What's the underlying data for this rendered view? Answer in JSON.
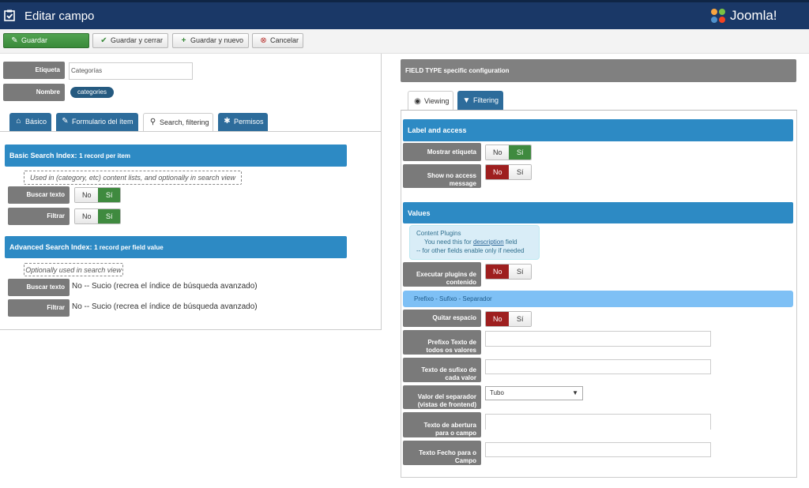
{
  "header": {
    "title": "Editar campo",
    "logo_text": "Joomla!"
  },
  "toolbar": {
    "save": "Guardar",
    "save_close": "Guardar y cerrar",
    "save_new": "Guardar y nuevo",
    "cancel": "Cancelar"
  },
  "left": {
    "label_label": "Etiqueta",
    "label_value": "Categorías",
    "name_label": "Nombre",
    "name_value": "categories",
    "tabs": [
      "Básico",
      "Formulario del ítem",
      "Search, filtering",
      "Permisos"
    ],
    "basic_index": {
      "title": "Basic Search Index:",
      "subtitle": "1 record per item",
      "note": "Used in (category, etc) content lists, and optionally in search view",
      "search_text_label": "Buscar texto",
      "filter_label": "Filtrar",
      "no": "No",
      "yes": "Sí"
    },
    "advanced_index": {
      "title": "Advanced Search Index:",
      "subtitle": "1 record per field value",
      "note": "Optionally used in search view",
      "search_text_label": "Buscar texto",
      "search_text_value": "No -- Sucio (recrea el índice de búsqueda avanzado)",
      "filter_label": "Filtrar",
      "filter_value": "No -- Sucio (recrea el índice de búsqueda avanzado)"
    }
  },
  "right": {
    "header": "FIELD TYPE specific configuration",
    "tabs": [
      "Viewing",
      "Filtering"
    ],
    "label_access": {
      "title": "Label and access",
      "show_label": "Mostrar etiqueta",
      "no_access_line1": "Show no access",
      "no_access_line2": "message"
    },
    "values": {
      "title": "Values",
      "info_title": "Content Plugins",
      "info_line1_pre": "You need this for ",
      "info_line1_link": "description",
      "info_line1_post": " field",
      "info_line2": "-- for other fields enable only if needed",
      "plugins_line1": "Executar plugins de",
      "plugins_line2": "contenido"
    },
    "prefix": {
      "bar": "Prefixo - Sufixo - Separador",
      "remove_space": "Quitar espacio",
      "prefix_line1": "Prefixo Texto de",
      "prefix_line2": "todos os valores",
      "suffix_line1": "Texto de sufixo de",
      "suffix_line2": "cada valor",
      "separator_line1": "Valor del separador",
      "separator_line2": "(vistas de frontend)",
      "separator_value": "Tubo",
      "open_line1": "Texto de abertura",
      "open_line2": "para o campo",
      "close_line1": "Texto Fecho para o",
      "close_line2": "Campo"
    },
    "no": "No",
    "yes": "Sí"
  }
}
